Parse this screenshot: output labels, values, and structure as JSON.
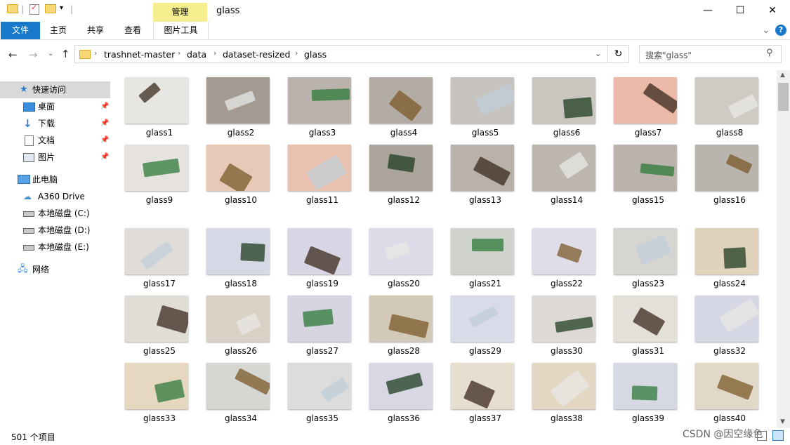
{
  "window": {
    "title": "glass",
    "context_tab": "管理",
    "controls": {
      "minimize": "—",
      "maximize": "☐",
      "close": "✕"
    }
  },
  "ribbon": {
    "tabs": [
      "文件",
      "主页",
      "共享",
      "查看",
      "图片工具"
    ],
    "help": "?",
    "collapse": "⌄"
  },
  "address": {
    "path": [
      "trashnet-master",
      "data",
      "dataset-resized",
      "glass"
    ],
    "search_placeholder": "搜索\"glass\""
  },
  "nav": {
    "quick_access": "快速访问",
    "quick_items": [
      "桌面",
      "下载",
      "文档",
      "图片"
    ],
    "this_pc": "此电脑",
    "pc_items": [
      "A360 Drive",
      "本地磁盘 (C:)",
      "本地磁盘 (D:)",
      "本地磁盘 (E:)"
    ],
    "network": "网络"
  },
  "files": [
    "glass1",
    "glass2",
    "glass3",
    "glass4",
    "glass5",
    "glass6",
    "glass7",
    "glass8",
    "glass9",
    "glass10",
    "glass11",
    "glass12",
    "glass13",
    "glass14",
    "glass15",
    "glass16",
    "glass17",
    "glass18",
    "glass19",
    "glass20",
    "glass21",
    "glass22",
    "glass23",
    "glass24",
    "glass25",
    "glass26",
    "glass27",
    "glass28",
    "glass29",
    "glass30",
    "glass31",
    "glass32",
    "glass33",
    "glass34",
    "glass35",
    "glass36",
    "glass37",
    "glass38",
    "glass39",
    "glass40"
  ],
  "thumb_colors": [
    "#e8e6e2",
    "#a39a92",
    "#b9b3ab",
    "#b2aca4",
    "#c6c2bd",
    "#c9c5bf",
    "#eab9a8",
    "#cfcac4",
    "#e6e2dd",
    "#e8c9b8",
    "#e9c1b0",
    "#aaa49c",
    "#b8b2aa",
    "#bcb6ae",
    "#bab4ac",
    "#b9b4ad",
    "#e0ddd8",
    "#d7d8e6",
    "#d8d6e4",
    "#dcdbe8",
    "#cfd3cc",
    "#dedde8",
    "#d6d5d2",
    "#e1d2bb",
    "#e0dcd6",
    "#d9d0c6",
    "#d5d4e0",
    "#d3c9b8",
    "#dadbe9",
    "#ddd9d4",
    "#e3e0da",
    "#d6d7e5",
    "#e5d7c0",
    "#d6d7d3",
    "#dcdcdc",
    "#d8d7e3",
    "#e6dfcf",
    "#e3d6c2",
    "#d6d8e2",
    "#e1d8c8"
  ],
  "status": {
    "item_count": "501 个项目",
    "watermark": "CSDN @因空缘色"
  }
}
